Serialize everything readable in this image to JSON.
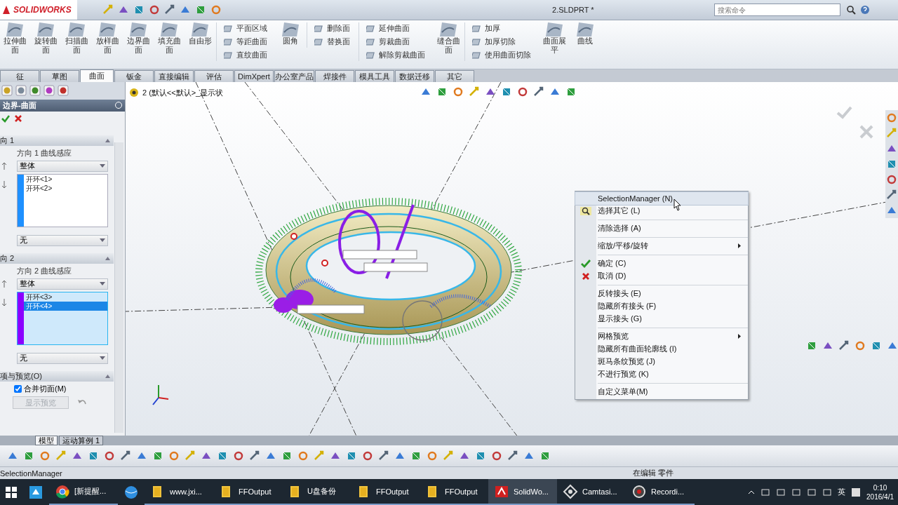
{
  "window": {
    "logo": "SOLIDWORKS",
    "title": "2.SLDPRT *",
    "search_placeholder": "搜索命令"
  },
  "ribbon": [
    {
      "kind": "large",
      "label": "拉伸曲面"
    },
    {
      "kind": "large",
      "label": "旋转曲面"
    },
    {
      "kind": "large",
      "label": "扫描曲面"
    },
    {
      "kind": "large",
      "label": "放样曲面"
    },
    {
      "kind": "large",
      "label": "边界曲面"
    },
    {
      "kind": "large",
      "label": "填充曲面"
    },
    {
      "kind": "large",
      "label": "自由形"
    },
    {
      "kind": "stack",
      "items": [
        "平面区域",
        "等距曲面",
        "直纹曲面"
      ]
    },
    {
      "kind": "large",
      "label": "圆角"
    },
    {
      "kind": "stack",
      "items": [
        "删除面",
        "替换面"
      ]
    },
    {
      "kind": "stack",
      "items": [
        "延伸曲面",
        "剪裁曲面",
        "解除剪裁曲面"
      ]
    },
    {
      "kind": "large",
      "label": "缝合曲面"
    },
    {
      "kind": "stack",
      "items": [
        "加厚",
        "加厚切除",
        "使用曲面切除"
      ]
    },
    {
      "kind": "large",
      "label": "曲面展平"
    },
    {
      "kind": "large",
      "label": "曲线"
    }
  ],
  "command_tabs": [
    {
      "label": "征",
      "selected": false
    },
    {
      "label": "草图",
      "selected": false
    },
    {
      "label": "曲面",
      "selected": true
    },
    {
      "label": "钣金",
      "selected": false
    },
    {
      "label": "直接编辑",
      "selected": false
    },
    {
      "label": "评估",
      "selected": false
    },
    {
      "label": "DimXpert",
      "selected": false
    },
    {
      "label": "办公室产品",
      "selected": false
    },
    {
      "label": "焊接件",
      "selected": false
    },
    {
      "label": "模具工具",
      "selected": false
    },
    {
      "label": "数据迁移",
      "selected": false
    },
    {
      "label": "其它",
      "selected": false
    }
  ],
  "property_manager": {
    "title": "边界-曲面",
    "sections": [
      {
        "kind": "direction",
        "title": "向 1",
        "subtitle": "方向 1 曲线感应",
        "mode": "整体",
        "color": "#1e90ff",
        "active": false,
        "items": [
          {
            "label": "开环<1>",
            "selected": false
          },
          {
            "label": "开环<2>",
            "selected": false
          }
        ],
        "tangency": "无"
      },
      {
        "kind": "direction",
        "title": "向 2",
        "subtitle": "方向 2 曲线感应",
        "mode": "整体",
        "color": "#8b00ff",
        "active": true,
        "items": [
          {
            "label": "开环<3>",
            "selected": false
          },
          {
            "label": "开环<4>",
            "selected": true
          }
        ],
        "tangency": "无"
      },
      {
        "kind": "options",
        "title": "项与预览(O)",
        "checkbox": {
          "label": "合并切面(M)",
          "checked": true
        },
        "button": {
          "label": "显示预览",
          "disabled": true
        }
      }
    ]
  },
  "viewport": {
    "tree_label": "2  (默认<<默认>_显示状",
    "context_menu": [
      [
        {
          "label": "SelectionManager (N)",
          "kind": "plain",
          "submenu": false,
          "highlighted": true
        },
        {
          "label": "选择其它 (L)",
          "kind": "select",
          "submenu": false,
          "highlighted": false
        }
      ],
      [
        {
          "label": "清除选择 (A)",
          "kind": "plain",
          "submenu": false,
          "highlighted": false
        }
      ],
      [
        {
          "label": "缩放/平移/旋转",
          "kind": "plain",
          "submenu": true,
          "highlighted": false
        }
      ],
      [
        {
          "label": "确定 (C)",
          "kind": "ok",
          "submenu": false,
          "highlighted": false
        },
        {
          "label": "取消 (D)",
          "kind": "cancel",
          "submenu": false,
          "highlighted": false
        }
      ],
      [
        {
          "label": "反转接头 (E)",
          "kind": "plain",
          "submenu": false,
          "highlighted": false
        },
        {
          "label": "隐藏所有接头 (F)",
          "kind": "plain",
          "submenu": false,
          "highlighted": false
        },
        {
          "label": "显示接头 (G)",
          "kind": "plain",
          "submenu": false,
          "highlighted": false
        }
      ],
      [
        {
          "label": "网格预览",
          "kind": "plain",
          "submenu": true,
          "highlighted": false
        },
        {
          "label": "隐藏所有曲面轮廓线 (I)",
          "kind": "plain",
          "submenu": false,
          "highlighted": false
        },
        {
          "label": "斑马条纹预览 (J)",
          "kind": "plain",
          "submenu": false,
          "highlighted": false
        },
        {
          "label": "不进行预览 (K)",
          "kind": "plain",
          "submenu": false,
          "highlighted": false
        }
      ],
      [
        {
          "label": "自定义菜单(M)",
          "kind": "plain",
          "submenu": false,
          "highlighted": false
        }
      ]
    ]
  },
  "model_tabs": [
    {
      "label": "模型",
      "selected": true
    },
    {
      "label": "运动算例 1",
      "selected": false
    }
  ],
  "status_bar": {
    "left": "SelectionManager",
    "right": "在编辑 零件"
  },
  "taskbar": {
    "items": [
      {
        "kind": "store",
        "active": false
      },
      {
        "kind": "chrome",
        "label": "[新提醒...",
        "active": false
      },
      {
        "kind": "globe",
        "active": false
      },
      {
        "kind": "folder",
        "label": "www.jxi...",
        "active": false
      },
      {
        "kind": "folder",
        "label": "FFOutput",
        "active": false
      },
      {
        "kind": "folder",
        "label": "U盘备份",
        "active": false
      },
      {
        "kind": "folder",
        "label": "FFOutput",
        "active": false
      },
      {
        "kind": "folder",
        "label": "FFOutput",
        "active": false
      },
      {
        "kind": "solidworks",
        "label": "SolidWo...",
        "active": true
      },
      {
        "kind": "camtasia",
        "label": "Camtasi...",
        "active": false
      },
      {
        "kind": "recorder",
        "label": "Recordi...",
        "active": false
      }
    ],
    "language": "英",
    "time": "0:10",
    "date": "2016/4/1"
  }
}
